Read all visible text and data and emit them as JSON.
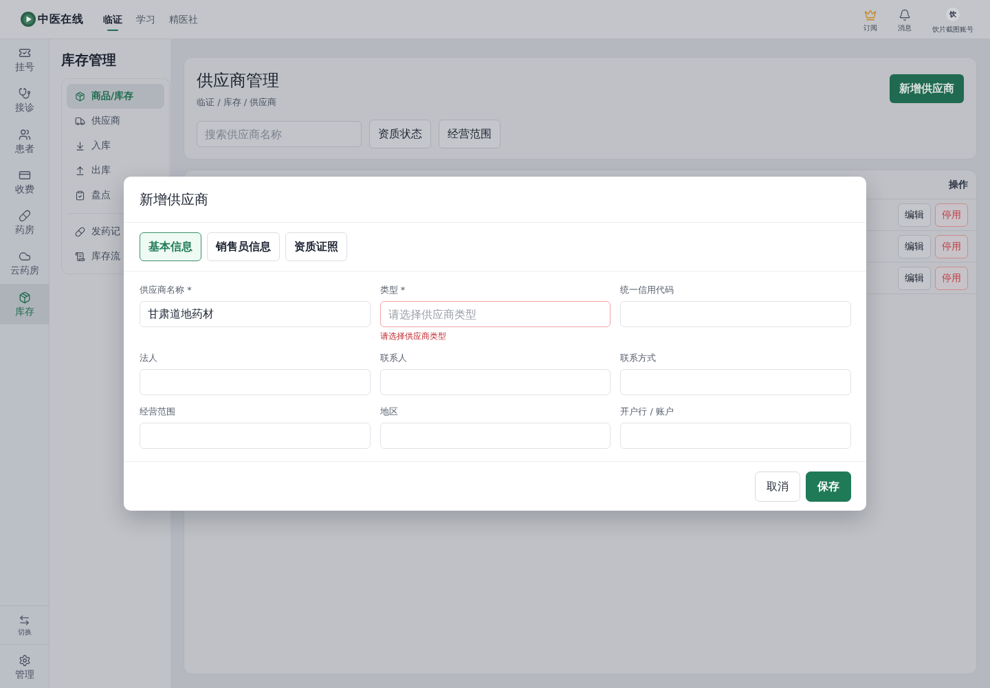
{
  "top_bar": {
    "logo": "中医在线",
    "nav": [
      {
        "label": "临证",
        "selected": true
      },
      {
        "label": "学习",
        "selected": false
      },
      {
        "label": "精医社",
        "selected": false
      }
    ],
    "actions": [
      {
        "kind": "icon",
        "label": "订阅"
      },
      {
        "kind": "icon",
        "label": "消息"
      },
      {
        "kind": "avatar",
        "avatar": "饮",
        "label": "饮片截图账号"
      }
    ]
  },
  "sidebar": {
    "items": [
      {
        "label": "挂号",
        "selected": false
      },
      {
        "label": "接诊",
        "selected": false
      },
      {
        "label": "患者",
        "selected": false
      },
      {
        "label": "收费",
        "selected": false
      },
      {
        "label": "药房",
        "selected": false
      },
      {
        "label": "云药房",
        "selected": false
      },
      {
        "label": "库存",
        "selected": true
      }
    ],
    "bottom_items": [
      {
        "label": "切换"
      },
      {
        "label": "管理"
      }
    ]
  },
  "inventory_nav": {
    "title": "库存管理",
    "groups": [
      {
        "items": [
          {
            "label": "商品/库存",
            "selected": true
          },
          {
            "label": "供应商",
            "selected": false
          },
          {
            "label": "入库",
            "selected": false
          },
          {
            "label": "出库",
            "selected": false
          },
          {
            "label": "盘点",
            "selected": false
          }
        ]
      },
      {
        "items": [
          {
            "label": "发药记",
            "selected": false
          },
          {
            "label": "库存流",
            "selected": false
          }
        ]
      }
    ]
  },
  "page_header": {
    "title": "供应商管理",
    "breadcrumb": "临证 / 库存 / 供应商",
    "primary_button": "新增供应商",
    "search": {
      "placeholder": "搜索供应商名称"
    },
    "filters": [
      "资质状态",
      "经营范围"
    ]
  },
  "table": {
    "column_header": "操作",
    "rows": [
      {
        "actions": [
          {
            "kind": "default",
            "label": "编辑"
          },
          {
            "kind": "danger",
            "label": "停用"
          }
        ]
      },
      {
        "actions": [
          {
            "kind": "default",
            "label": "编辑"
          },
          {
            "kind": "danger",
            "label": "停用"
          }
        ]
      },
      {
        "actions": [
          {
            "kind": "default",
            "label": "编辑"
          },
          {
            "kind": "danger",
            "label": "停用"
          }
        ]
      }
    ]
  },
  "dialog": {
    "title": "新增供应商",
    "tabs": [
      {
        "label": "基本信息",
        "selected": true
      },
      {
        "label": "销售员信息",
        "selected": false
      },
      {
        "label": "资质证照",
        "selected": false
      }
    ],
    "fields": [
      {
        "label": "供应商名称 *",
        "value": "甘肃道地药材"
      },
      {
        "label": "类型 *",
        "placeholder": "请选择供应商类型",
        "error": "请选择供应商类型"
      },
      {
        "label": "统一信用代码"
      },
      {
        "label": "法人"
      },
      {
        "label": "联系人"
      },
      {
        "label": "联系方式"
      },
      {
        "label": "经营范围"
      },
      {
        "label": "地区"
      },
      {
        "label": "开户行 / 账户"
      }
    ],
    "buttons": [
      {
        "kind": "secondary",
        "label": "取消"
      },
      {
        "kind": "primary",
        "label": "保存"
      }
    ]
  }
}
